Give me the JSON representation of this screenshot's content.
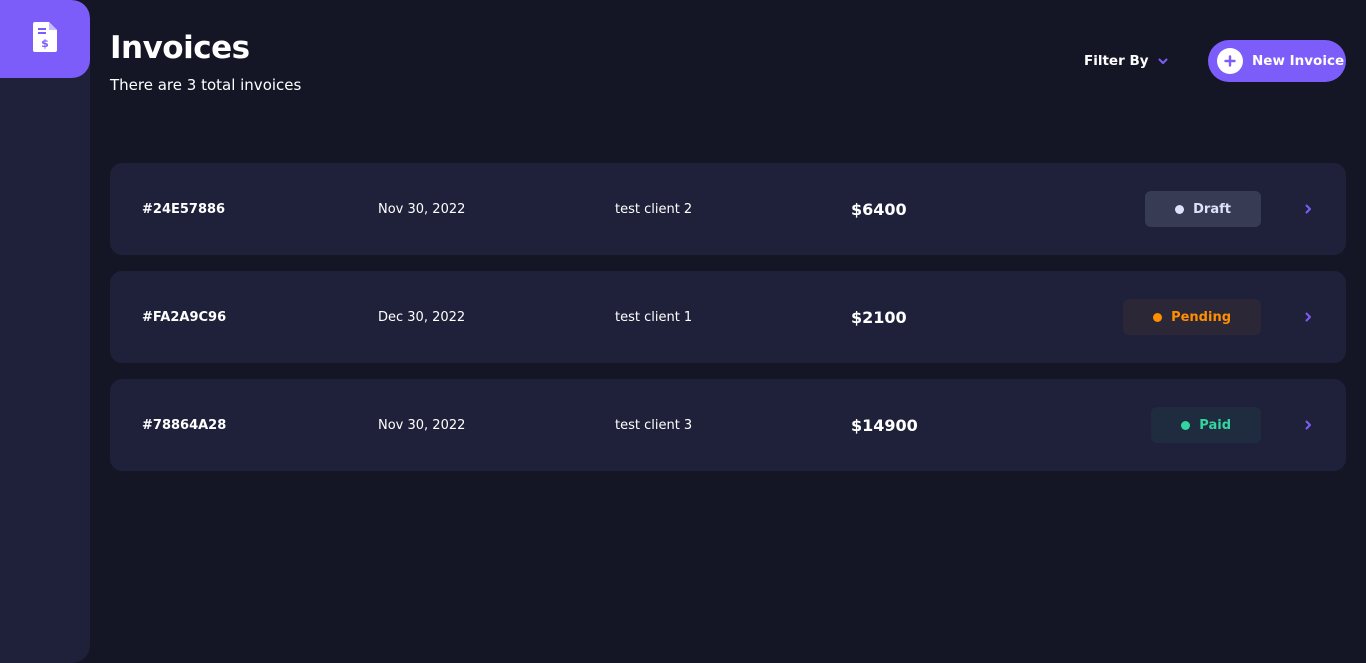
{
  "sidebar": {
    "logo_icon": "invoice-dollar-icon",
    "accent": "#7c5dfa"
  },
  "header": {
    "title": "Invoices",
    "subtitle": "There are 3 total invoices",
    "filter_label": "Filter By",
    "filter_icon": "chevron-down-icon",
    "new_invoice_label": "New Invoice",
    "new_invoice_icon": "plus-icon"
  },
  "invoices": [
    {
      "id": "#24E57886",
      "date": "Nov 30, 2022",
      "client": "test client 2",
      "amount": "$6400",
      "status": "Draft",
      "status_color": "#dfe3fa",
      "status_bg": "#373b53"
    },
    {
      "id": "#FA2A9C96",
      "date": "Dec 30, 2022",
      "client": "test client 1",
      "amount": "$2100",
      "status": "Pending",
      "status_color": "#ff8f00",
      "status_bg": "#2b2736"
    },
    {
      "id": "#78864A28",
      "date": "Nov 30, 2022",
      "client": "test client 3",
      "amount": "$14900",
      "status": "Paid",
      "status_color": "#33d69f",
      "status_bg": "#1f2c3f"
    }
  ],
  "colors": {
    "background": "#141625",
    "card": "#1e2139",
    "accent": "#7c5dfa"
  }
}
